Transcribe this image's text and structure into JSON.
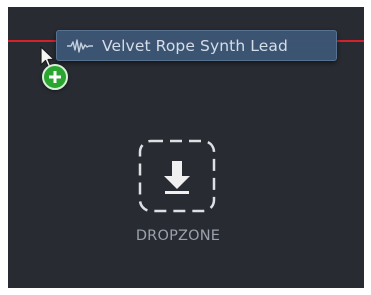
{
  "drag_item": {
    "name": "Velvet Rope Synth Lead",
    "icon": "waveform-icon"
  },
  "cursor": {
    "icon": "arrow-cursor-icon",
    "badge_icon": "plus-icon"
  },
  "dropzone": {
    "label": "DROPZONE",
    "icon": "download-arrow-icon"
  },
  "colors": {
    "panel_background": "#282c32",
    "insert_line": "#d5222a",
    "chip_background": "#3c5674",
    "chip_text": "#dbe5f1",
    "badge_green": "#2aa52f",
    "dropzone_text": "#9aa1ab"
  }
}
